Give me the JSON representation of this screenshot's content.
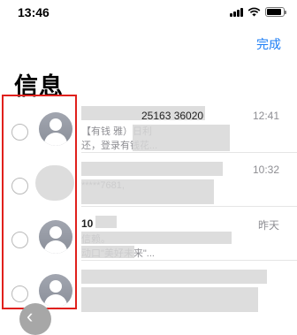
{
  "status_bar": {
    "time": "13:46",
    "battery_level": 0.9
  },
  "header": {
    "done_label": "完成",
    "title": "信息"
  },
  "messages": [
    {
      "sender": "",
      "sender_suffix": "25163  36020",
      "time": "12:41",
      "preview_line1": "【有钱            雅）日利",
      "preview_line2": "                 还，登录有钱花..."
    },
    {
      "sender": "",
      "sender_suffix": "",
      "time": "10:32",
      "preview_line1": "",
      "preview_line2": "             *****7681,"
    },
    {
      "sender": "10",
      "sender_suffix": "",
      "time": "昨天",
      "preview_line1": "            信赖。",
      "preview_line2": "       动口\"美好未来\"..."
    },
    {
      "sender": "",
      "sender_suffix": "",
      "time": "",
      "preview_line1": "",
      "preview_line2": ""
    }
  ],
  "colors": {
    "accent": "#1a7cf5",
    "selection_box": "#e0201c"
  },
  "icons": [
    "signal-icon",
    "wifi-icon",
    "battery-icon",
    "avatar-icon",
    "back-chevron-icon"
  ]
}
